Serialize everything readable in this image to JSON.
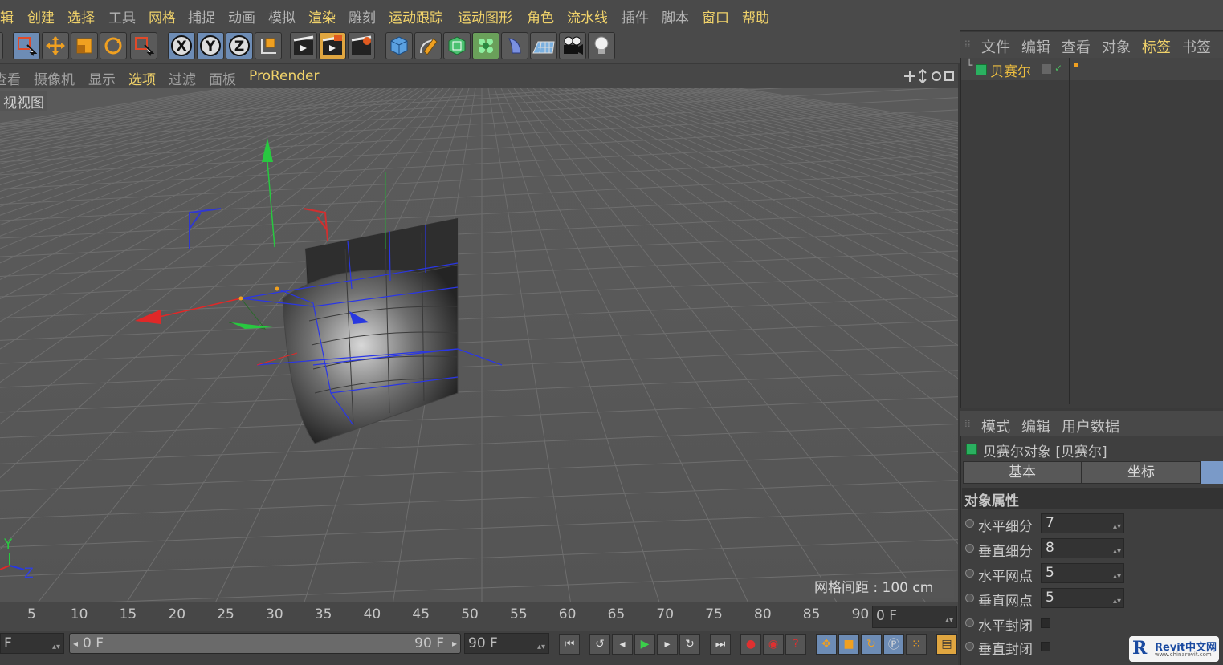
{
  "menu": {
    "items": [
      {
        "label": "编辑",
        "partial": "辑",
        "dim": false
      },
      {
        "label": "创建",
        "dim": false
      },
      {
        "label": "选择",
        "dim": false
      },
      {
        "label": "工具",
        "dim": true
      },
      {
        "label": "网格",
        "dim": false
      },
      {
        "label": "捕捉",
        "dim": true
      },
      {
        "label": "动画",
        "dim": true
      },
      {
        "label": "模拟",
        "dim": true
      },
      {
        "label": "渲染",
        "dim": false
      },
      {
        "label": "雕刻",
        "dim": true
      },
      {
        "label": "运动跟踪",
        "dim": false
      },
      {
        "label": "运动图形",
        "dim": false
      },
      {
        "label": "角色",
        "dim": false
      },
      {
        "label": "流水线",
        "dim": false
      },
      {
        "label": "插件",
        "dim": true
      },
      {
        "label": "脚本",
        "dim": true
      },
      {
        "label": "窗口",
        "dim": false
      },
      {
        "label": "帮助",
        "dim": false
      }
    ],
    "first_visible": "辑"
  },
  "toolbar": {
    "icons": [
      "live-select-icon",
      "move-icon",
      "scale-icon",
      "rotate-icon",
      "recent-tool-icon",
      "x-axis-lock-icon",
      "y-axis-lock-icon",
      "z-axis-lock-icon",
      "coordinate-system-icon",
      "render-view-icon",
      "render-picture-viewer-icon",
      "render-settings-icon",
      "cube-object-icon",
      "pen-spline-icon",
      "subdivision-surface-icon",
      "cloner-icon",
      "deformer-icon",
      "floor-icon",
      "camera-icon",
      "light-icon"
    ],
    "axis_labels": [
      "X",
      "Y",
      "Z"
    ]
  },
  "viewport": {
    "menu": [
      "查看",
      "摄像机",
      "显示",
      "选项",
      "过滤",
      "面板",
      "ProRender"
    ],
    "menu_first_partial": "查看",
    "active_menu": "选项",
    "title": "透视视图",
    "title_visible": "视视图",
    "grid_spacing": "网格间距 : 100 cm",
    "axis_y": "Y",
    "axis_z": "Z"
  },
  "object_manager": {
    "tabs": [
      "文件",
      "编辑",
      "查看",
      "对象",
      "标签",
      "书签"
    ],
    "active_tab": "标签",
    "objects": [
      {
        "name": "贝赛尔"
      }
    ]
  },
  "attribute_manager": {
    "tabs": [
      "模式",
      "编辑",
      "用户数据"
    ],
    "object_title": "贝赛尔对象 [贝赛尔]",
    "subtabs": [
      "基本",
      "坐标"
    ],
    "section": "对象属性",
    "properties": [
      {
        "label": "水平细分",
        "value": "7",
        "type": "number"
      },
      {
        "label": "垂直细分",
        "value": "8",
        "type": "number"
      },
      {
        "label": "水平网点",
        "value": "5",
        "type": "number"
      },
      {
        "label": "垂直网点",
        "value": "5",
        "type": "number"
      },
      {
        "label": "水平封闭",
        "type": "checkbox",
        "checked": false
      },
      {
        "label": "垂直封闭",
        "type": "checkbox",
        "checked": false
      }
    ]
  },
  "timeline": {
    "ticks": [
      "5",
      "10",
      "15",
      "20",
      "25",
      "30",
      "35",
      "40",
      "45",
      "50",
      "55",
      "60",
      "65",
      "70",
      "75",
      "80",
      "85",
      "90"
    ],
    "current_frame": "0 F",
    "start_field": "F",
    "range_start": "0 F",
    "range_end": "90 F",
    "end_field": "90 F"
  },
  "watermark": {
    "text": "Revit中文网",
    "url": "www.chinarevit.com"
  },
  "colors": {
    "accent": "#f0d26a",
    "x_axis": "#e02828",
    "y_axis": "#28c840",
    "z_axis": "#2838e0",
    "selection": "#6d8cb5"
  }
}
